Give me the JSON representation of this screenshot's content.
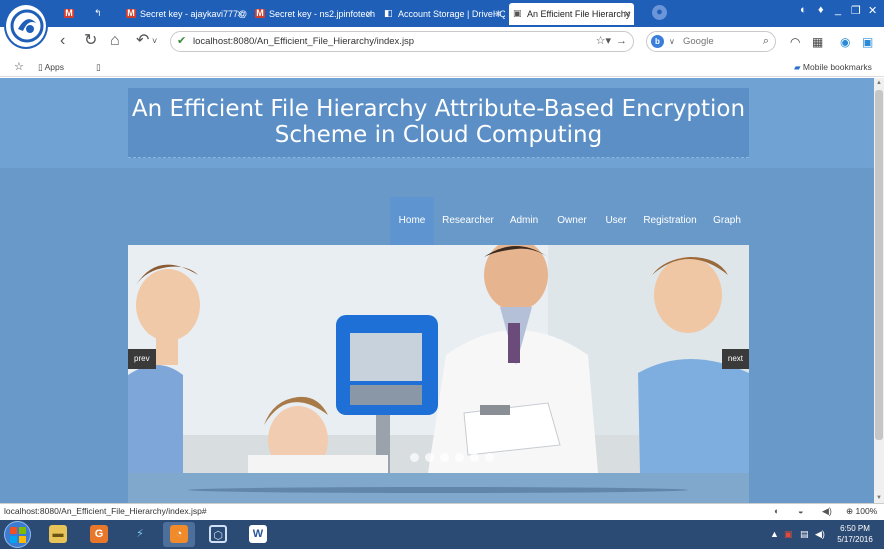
{
  "browser": {
    "tabs": [
      {
        "label": "",
        "icon": "gmail-icon"
      },
      {
        "label": "",
        "icon": "mail-reply-icon"
      },
      {
        "label": "Secret key - ajaykavi777@",
        "icon": "gmail-icon"
      },
      {
        "label": "Secret key - ns2.jpinfotech",
        "icon": "gmail-icon"
      },
      {
        "label": "Account Storage | DriveHQ",
        "icon": "drivehq-icon"
      },
      {
        "label": "An Efficient File Hierarchy",
        "icon": "page-icon",
        "active": true
      }
    ],
    "address_url": "localhost:8080/An_Efficient_File_Hierarchy/index.jsp",
    "search_engine": "Google",
    "search_placeholder": "Google",
    "bookmarks": {
      "apps_label": "Apps",
      "mobile_bookmarks_label": "Mobile bookmarks"
    },
    "accent_color": "#1f5fb8"
  },
  "page": {
    "title_line1": "An Efficient File Hierarchy Attribute-Based Encryption",
    "title_line2": "Scheme in Cloud Computing",
    "nav": [
      {
        "label": "Home",
        "active": true
      },
      {
        "label": "Researcher"
      },
      {
        "label": "Admin"
      },
      {
        "label": "Owner"
      },
      {
        "label": "User"
      },
      {
        "label": "Registration"
      },
      {
        "label": "Graph"
      }
    ],
    "slider": {
      "prev_label": "prev",
      "next_label": "next",
      "dot_count": 6
    },
    "background_color": "#6999c9",
    "title_box_color": "#5b8fc6"
  },
  "status": {
    "hover_url": "localhost:8080/An_Efficient_File_Hierarchy/index.jsp#",
    "zoom": "100%"
  },
  "taskbar": {
    "time": "6:50 PM",
    "date": "5/17/2016"
  }
}
